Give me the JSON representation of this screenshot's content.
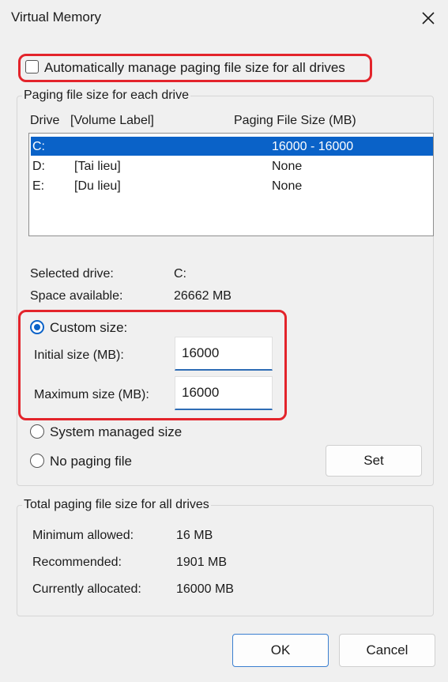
{
  "window": {
    "title": "Virtual Memory"
  },
  "auto_manage": {
    "label": "Automatically manage paging file size for all drives",
    "checked": false
  },
  "paging_group": {
    "legend": "Paging file size for each drive",
    "headers": {
      "drive": "Drive",
      "volume": "[Volume Label]",
      "size": "Paging File Size (MB)"
    },
    "rows": [
      {
        "drive": "C:",
        "volume": "",
        "size": "16000 - 16000",
        "selected": true
      },
      {
        "drive": "D:",
        "volume": "[Tai lieu]",
        "size": "None",
        "selected": false
      },
      {
        "drive": "E:",
        "volume": "[Du lieu]",
        "size": "None",
        "selected": false
      }
    ],
    "selected_drive_label": "Selected drive:",
    "selected_drive_value": "C:",
    "space_label": "Space available:",
    "space_value": "26662 MB",
    "custom_size_label": "Custom size:",
    "initial_label": "Initial size (MB):",
    "initial_value": "16000",
    "maximum_label": "Maximum size (MB):",
    "maximum_value": "16000",
    "system_managed_label": "System managed size",
    "no_paging_label": "No paging file",
    "set_label": "Set"
  },
  "total_group": {
    "legend": "Total paging file size for all drives",
    "min_label": "Minimum allowed:",
    "min_value": "16 MB",
    "rec_label": "Recommended:",
    "rec_value": "1901 MB",
    "alloc_label": "Currently allocated:",
    "alloc_value": "16000 MB"
  },
  "buttons": {
    "ok": "OK",
    "cancel": "Cancel"
  },
  "colors": {
    "highlight": "#e3242b",
    "accent": "#0a62c8"
  },
  "icons": {
    "close": "close-icon"
  }
}
